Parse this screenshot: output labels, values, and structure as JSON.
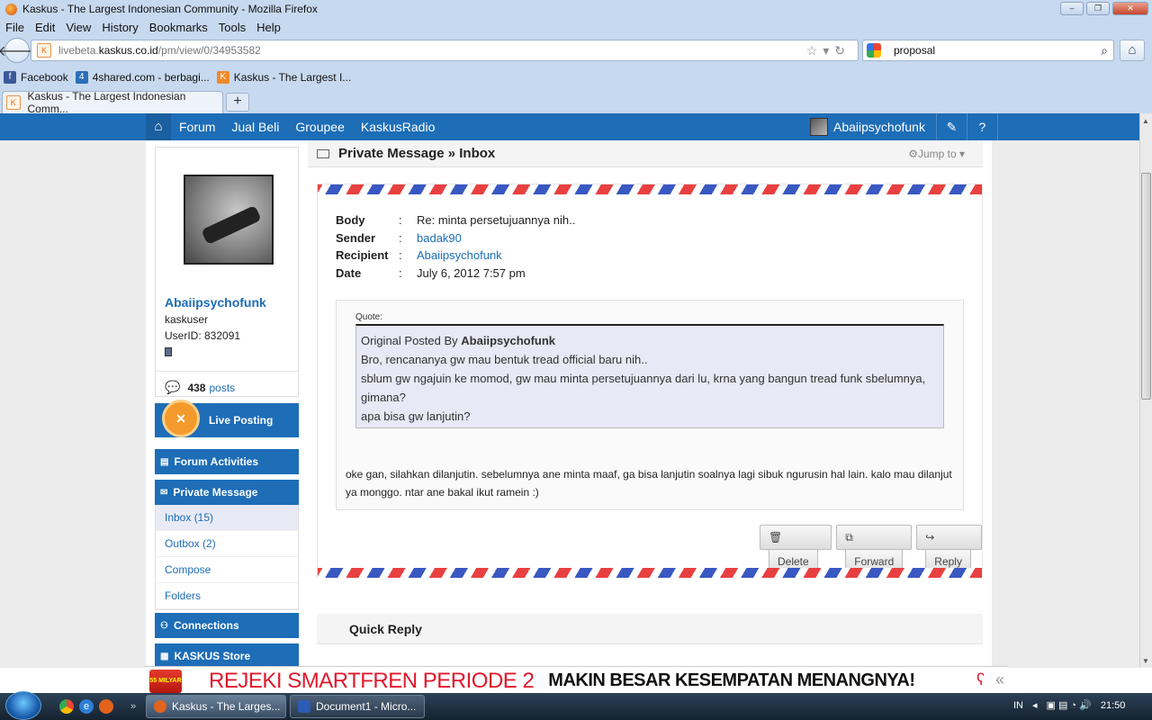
{
  "window": {
    "title": "Kaskus - The Largest Indonesian Community - Mozilla Firefox",
    "menu": [
      "File",
      "Edit",
      "View",
      "History",
      "Bookmarks",
      "Tools",
      "Help"
    ]
  },
  "browser": {
    "url_prefix": "livebeta.",
    "url_domain": "kaskus.co.id",
    "url_path": "/pm/view/0/34953582",
    "search_value": "proposal",
    "bookmarks": [
      "Facebook",
      "4shared.com - berbagi...",
      "Kaskus - The Largest I..."
    ],
    "tab_title": "Kaskus - The Largest Indonesian Comm...",
    "new_tab": "+"
  },
  "site": {
    "nav": [
      "Forum",
      "Jual Beli",
      "Groupee",
      "KaskusRadio"
    ],
    "username": "Abaiipsychofunk"
  },
  "profile": {
    "username": "Abaiipsychofunk",
    "rank": "kaskuser",
    "user_id": "UserID: 832091",
    "post_count": "438",
    "posts_label": "posts"
  },
  "sidebar": {
    "live_posting": "Live Posting",
    "forum_activities": "Forum Activities",
    "private_message": "Private Message",
    "pm_items": [
      "Inbox (15)",
      "Outbox (2)",
      "Compose",
      "Folders"
    ],
    "connections": "Connections",
    "store": "KASKUS Store"
  },
  "main": {
    "heading": "Private Message » Inbox",
    "jump_to": "Jump to",
    "fields": [
      {
        "key": "Body",
        "value": "Re: minta persetujuannya nih..",
        "link": false
      },
      {
        "key": "Sender",
        "value": "badak90",
        "link": true
      },
      {
        "key": "Recipient",
        "value": "Abaiipsychofunk",
        "link": true
      },
      {
        "key": "Date",
        "value": "July 6, 2012 7:57 pm",
        "link": false
      }
    ],
    "quote_label": "Quote:",
    "quote_prefix": "Original Posted By",
    "quote_author": "Abaiipsychofunk",
    "quote_lines": [
      "Bro, rencananya gw mau bentuk tread official baru nih..",
      "sblum gw ngajuin ke momod, gw mau minta persetujuannya dari lu, krna yang bangun tread funk sbelumnya, gimana?",
      "apa bisa gw lanjutin?"
    ],
    "reply_text": "oke gan, silahkan dilanjutin. sebelumnya ane minta maaf, ga bisa lanjutin soalnya lagi sibuk ngurusin hal lain. kalo mau dilanjut ya monggo. ntar ane bakal ikut ramein :)",
    "buttons": {
      "delete": "Delete",
      "forward": "Forward",
      "reply": "Reply"
    },
    "quick_reply": "Quick Reply"
  },
  "ad": {
    "badge": "55 MILYAR",
    "headline": "REJEKI SMARTFREN PERIODE 2",
    "tagline": "MAKIN BESAR KESEMPATAN MENANGNYA!"
  },
  "taskbar": {
    "tasks": [
      "Kaskus - The Larges...",
      "Document1 - Micro..."
    ],
    "lang": "IN",
    "clock": "21:50"
  },
  "colors": {
    "kaskus_blue": "#1d6db7",
    "chrome_bg": "#c7d9ef",
    "ad_red": "#e0192d"
  }
}
